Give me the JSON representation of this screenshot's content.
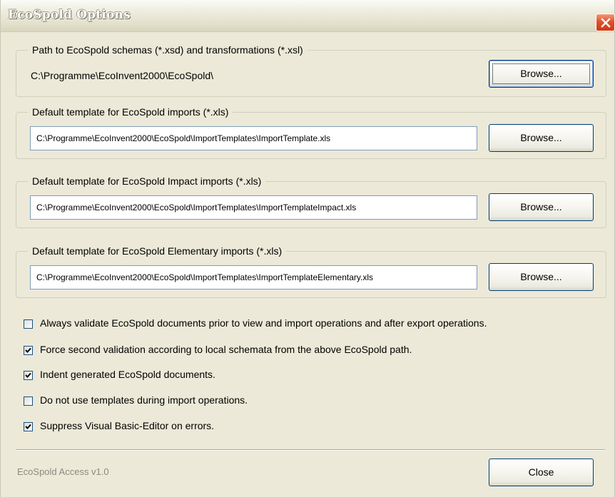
{
  "window": {
    "title": "EcoSpold Options",
    "close_icon": "close-x-icon"
  },
  "groups": {
    "schemas": {
      "legend": "Path to EcoSpold schemas (*.xsd) and transformations (*.xsl)",
      "path": "C:\\Programme\\EcoInvent2000\\EcoSpold\\",
      "browse_label": "Browse..."
    },
    "imports": {
      "legend": "Default template for EcoSpold imports (*.xls)",
      "value": "C:\\Programme\\EcoInvent2000\\EcoSpold\\ImportTemplates\\ImportTemplate.xls",
      "browse_label": "Browse..."
    },
    "impact": {
      "legend": "Default template for EcoSpold Impact imports (*.xls)",
      "value": "C:\\Programme\\EcoInvent2000\\EcoSpold\\ImportTemplates\\ImportTemplateImpact.xls",
      "browse_label": "Browse..."
    },
    "elementary": {
      "legend": "Default template for EcoSpold Elementary imports (*.xls)",
      "value": "C:\\Programme\\EcoInvent2000\\EcoSpold\\ImportTemplates\\ImportTemplateElementary.xls",
      "browse_label": "Browse..."
    }
  },
  "options": [
    {
      "label": "Always validate EcoSpold documents prior to view and import operations and after export operations.",
      "checked": false
    },
    {
      "label": "Force second validation according to local schemata from the above EcoSpold path.",
      "checked": true
    },
    {
      "label": "Indent generated EcoSpold documents.",
      "checked": true
    },
    {
      "label": "Do not use templates during import operations.",
      "checked": false
    },
    {
      "label": "Suppress Visual Basic-Editor on errors.",
      "checked": true
    }
  ],
  "footer": {
    "version": "EcoSpold Access v1.0",
    "close_label": "Close"
  },
  "colors": {
    "dialog_bg": "#ece9d8",
    "close_button": "#e2512a",
    "button_border": "#003c74"
  }
}
